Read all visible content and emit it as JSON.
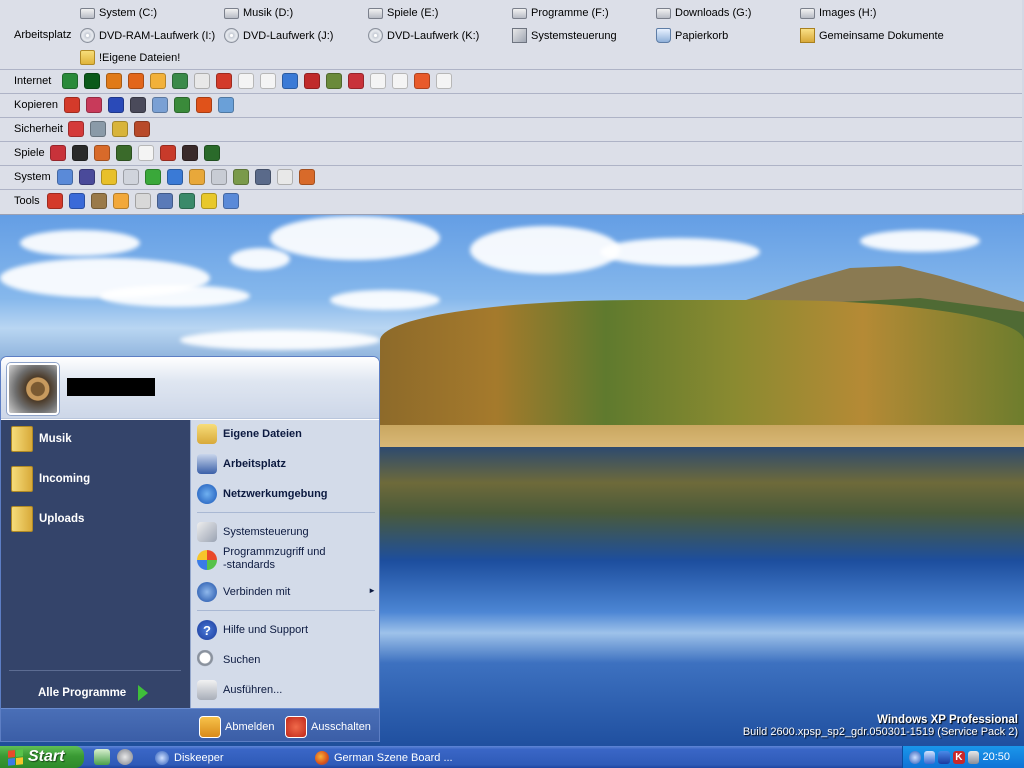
{
  "toolbar": {
    "arbeitsplatz_label": "Arbeitsplatz",
    "drives": [
      {
        "label": "System (C:)",
        "icon": "hard-drive-icon"
      },
      {
        "label": "Musik (D:)",
        "icon": "hard-drive-icon"
      },
      {
        "label": "Spiele (E:)",
        "icon": "hard-drive-icon"
      },
      {
        "label": "Programme (F:)",
        "icon": "hard-drive-icon"
      },
      {
        "label": "Downloads (G:)",
        "icon": "hard-drive-icon"
      },
      {
        "label": "Images (H:)",
        "icon": "hard-drive-icon"
      },
      {
        "label": "DVD-RAM-Laufwerk (I:)",
        "icon": "optical-drive-icon"
      },
      {
        "label": "DVD-Laufwerk (J:)",
        "icon": "optical-drive-icon"
      },
      {
        "label": "DVD-Laufwerk (K:)",
        "icon": "optical-drive-icon"
      },
      {
        "label": "Systemsteuerung",
        "icon": "control-panel-icon"
      },
      {
        "label": "Papierkorb",
        "icon": "recycle-bin-icon"
      },
      {
        "label": "Gemeinsame Dokumente",
        "icon": "shared-documents-icon"
      },
      {
        "label": "!Eigene Dateien!",
        "icon": "folder-icon"
      }
    ],
    "rows": [
      {
        "label": "Internet",
        "icon_count": 18,
        "colors": [
          "#2a8a3a",
          "#0b5a1a",
          "#e07a18",
          "#e2661a",
          "#f2b13a",
          "#3a8a4a",
          "#e8e8e8",
          "#d33a2a",
          "#f4f4f4",
          "#f4f4f4",
          "#3a7ad6",
          "#c02a2a",
          "#6a8a3a",
          "#c8323a",
          "#f4f4f4",
          "#f4f4f4",
          "#e85a2a",
          "#f4f4f4"
        ]
      },
      {
        "label": "Kopieren",
        "icon_count": 8,
        "colors": [
          "#d43a2a",
          "#c83a5a",
          "#2a4ab8",
          "#4a4a5a",
          "#7aa0d4",
          "#3a8a3a",
          "#e0521a",
          "#6aa0d8"
        ]
      },
      {
        "label": "Sicherheit",
        "icon_count": 4,
        "colors": [
          "#d43a3a",
          "#8a9aa8",
          "#d8b43a",
          "#b84a2a"
        ]
      },
      {
        "label": "Spiele",
        "icon_count": 8,
        "colors": [
          "#c8323a",
          "#2a2a2a",
          "#d86a2a",
          "#3a6a2a",
          "#f4f4f4",
          "#c83a2a",
          "#3a2a2a",
          "#2a6a2a"
        ]
      },
      {
        "label": "System",
        "icon_count": 12,
        "colors": [
          "#5a8ad8",
          "#4a4a9a",
          "#e8c02a",
          "#d0d4dc",
          "#3aa83a",
          "#3a7ad6",
          "#e8a83a",
          "#c8ccd4",
          "#7a9a4a",
          "#5a6a8a",
          "#e8e8e8",
          "#d86a2a"
        ]
      },
      {
        "label": "Tools",
        "icon_count": 9,
        "colors": [
          "#d43a2a",
          "#3a6ad8",
          "#9a7a4a",
          "#f2a83a",
          "#d8d8d8",
          "#5a7ab8",
          "#3a8a6a",
          "#e8c82a",
          "#5a8ad8"
        ]
      }
    ]
  },
  "desktop": {
    "edition": "Windows XP Professional",
    "build": "Build 2600.xpsp_sp2_gdr.050301-1519 (Service Pack 2)"
  },
  "startmenu": {
    "pinned": [
      {
        "label": "Musik"
      },
      {
        "label": "Incoming"
      },
      {
        "label": "Uploads"
      }
    ],
    "all_programs": "Alle Programme",
    "right": {
      "eigene_dateien": "Eigene Dateien",
      "arbeitsplatz": "Arbeitsplatz",
      "netzwerk": "Netzwerkumgebung",
      "systemsteuerung": "Systemsteuerung",
      "programmzugriff_1": "Programmzugriff und",
      "programmzugriff_2": "-standards",
      "verbinden": "Verbinden mit",
      "hilfe": "Hilfe und Support",
      "suchen": "Suchen",
      "ausfuehren": "Ausführen..."
    },
    "logoff": "Abmelden",
    "shutdown": "Ausschalten"
  },
  "taskbar": {
    "start": "Start",
    "buttons": [
      {
        "label": "Diskeeper",
        "icon": "diskeeper-icon"
      },
      {
        "label": "German Szene Board ...",
        "icon": "firefox-icon"
      }
    ],
    "clock": "20:50"
  }
}
